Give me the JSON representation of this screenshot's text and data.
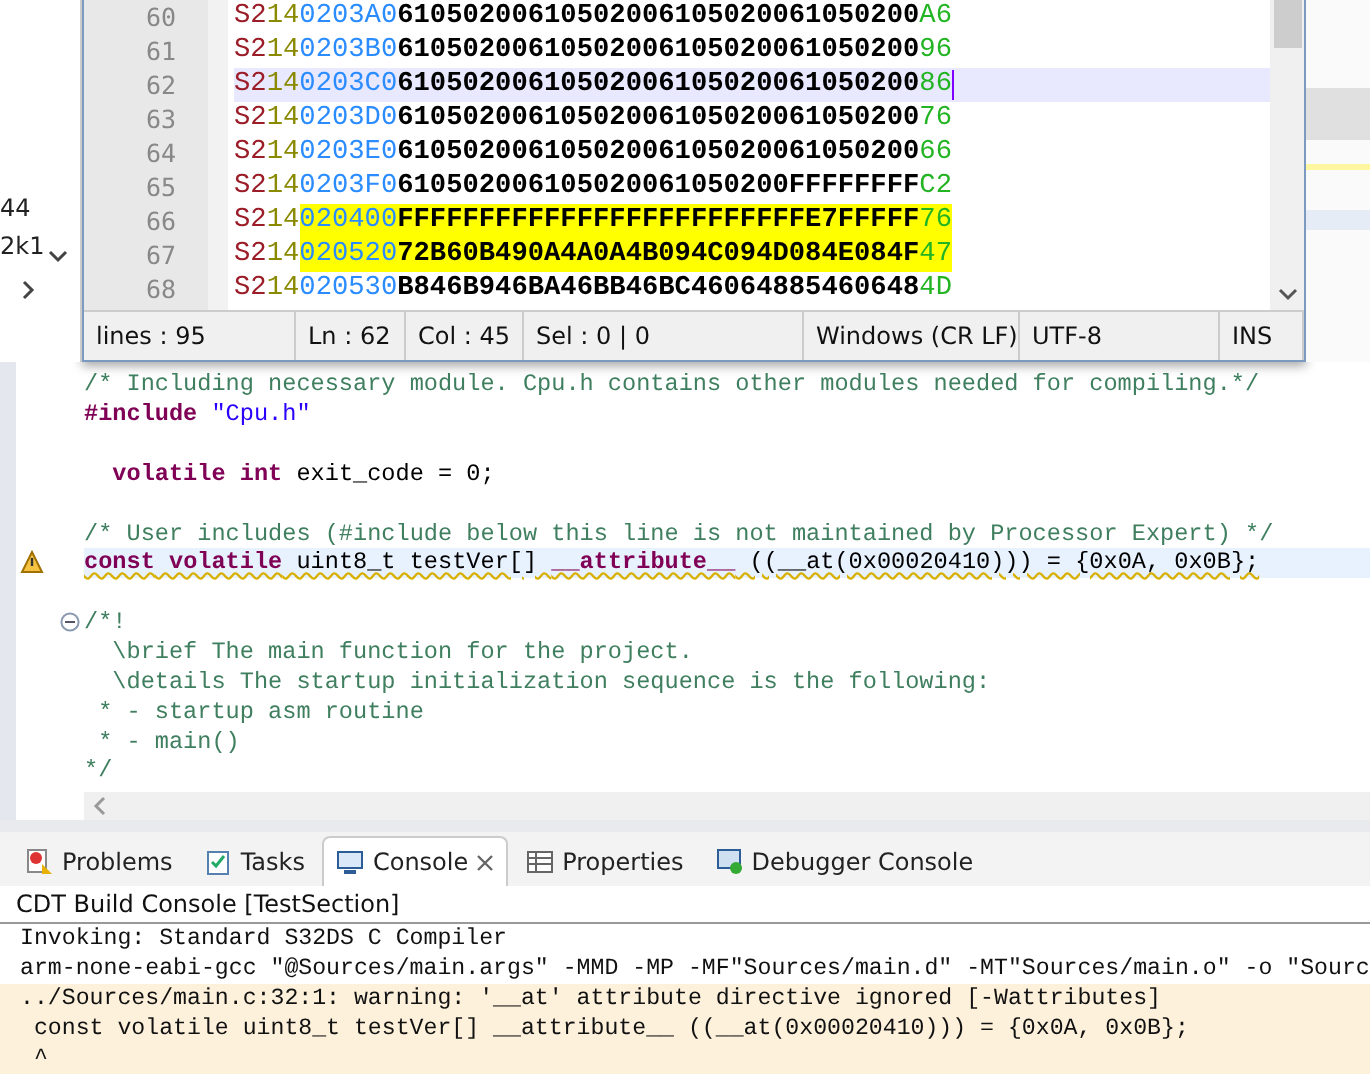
{
  "left_strip": {
    "texts": [
      "44",
      "2k1"
    ]
  },
  "hex_window": {
    "rows": [
      {
        "number": "60",
        "record": "S2",
        "count": "14",
        "address": "0203A0",
        "data": "61050200610502006105020061050200",
        "checksum": "A6",
        "highlighted": false,
        "current": false
      },
      {
        "number": "61",
        "record": "S2",
        "count": "14",
        "address": "0203B0",
        "data": "61050200610502006105020061050200",
        "checksum": "96",
        "highlighted": false,
        "current": false
      },
      {
        "number": "62",
        "record": "S2",
        "count": "14",
        "address": "0203C0",
        "data": "61050200610502006105020061050200",
        "checksum": "86",
        "highlighted": false,
        "current": true
      },
      {
        "number": "63",
        "record": "S2",
        "count": "14",
        "address": "0203D0",
        "data": "61050200610502006105020061050200",
        "checksum": "76",
        "highlighted": false,
        "current": false
      },
      {
        "number": "64",
        "record": "S2",
        "count": "14",
        "address": "0203E0",
        "data": "61050200610502006105020061050200",
        "checksum": "66",
        "highlighted": false,
        "current": false
      },
      {
        "number": "65",
        "record": "S2",
        "count": "14",
        "address": "0203F0",
        "data": "610502006105020061050200FFFFFFFF",
        "checksum": "C2",
        "highlighted": false,
        "current": false
      },
      {
        "number": "66",
        "record": "S2",
        "count": "14",
        "address": "020400",
        "data": "FFFFFFFFFFFFFFFFFFFFFFFFFE7FFFFF",
        "checksum": "76",
        "highlighted": true,
        "current": false
      },
      {
        "number": "67",
        "record": "S2",
        "count": "14",
        "address": "020520",
        "data": "72B60B490A4A0A4B094C094D084E084F",
        "checksum": "47",
        "highlighted": true,
        "current": false
      },
      {
        "number": "68",
        "record": "S2",
        "count": "14",
        "address": "020530",
        "data": "B846B946BA46BB46BC46064885460648",
        "checksum": "4D",
        "highlighted": false,
        "current": false
      }
    ],
    "status_bar": [
      "lines : 95",
      "Ln : 62",
      "Col : 45",
      "Sel : 0 | 0",
      "Windows (CR LF)",
      "UTF-8",
      "INS"
    ]
  },
  "editor": {
    "lines": [
      {
        "kind": "code",
        "warning": false,
        "tokens": [
          {
            "kind": "comment",
            "text": "/* Including necessary module. Cpu.h contains other modules needed for compiling.*/"
          }
        ]
      },
      {
        "kind": "code",
        "warning": false,
        "tokens": [
          {
            "kind": "preproc",
            "text": "#include"
          },
          {
            "kind": "string",
            "text": " \"Cpu.h\""
          }
        ]
      },
      {
        "kind": "blank",
        "warning": false
      },
      {
        "kind": "code",
        "warning": false,
        "tokens": [
          {
            "kind": "keyword",
            "text": "  volatile"
          },
          {
            "kind": "keyword",
            "text": " int"
          },
          {
            "kind": "plain",
            "text": " exit_code = 0;"
          }
        ]
      },
      {
        "kind": "blank",
        "warning": false
      },
      {
        "kind": "code",
        "warning": false,
        "tokens": [
          {
            "kind": "comment",
            "text": "/* User includes (#include below this line is not maintained by Processor Expert) */"
          }
        ]
      },
      {
        "kind": "code",
        "warning": true,
        "tokens": [
          {
            "kind": "keyword",
            "text": "const"
          },
          {
            "kind": "keyword",
            "text": " volatile"
          },
          {
            "kind": "plain",
            "text": " uint8_t testVer[] "
          },
          {
            "kind": "keyword",
            "text": "__attribute__"
          },
          {
            "kind": "plain",
            "text": " ((__at(0x00020410))) = {0x0A, 0x0B};"
          }
        ]
      },
      {
        "kind": "blank",
        "warning": false
      },
      {
        "kind": "fold",
        "warning": false,
        "tokens": [
          {
            "kind": "comment",
            "text": "/*!"
          }
        ]
      },
      {
        "kind": "code",
        "warning": false,
        "tokens": [
          {
            "kind": "comment",
            "text": "  \\brief The main function for the project."
          }
        ]
      },
      {
        "kind": "code",
        "warning": false,
        "tokens": [
          {
            "kind": "comment",
            "text": "  \\details The startup initialization sequence is the following:"
          }
        ]
      },
      {
        "kind": "code",
        "warning": false,
        "tokens": [
          {
            "kind": "comment",
            "text": " * - startup asm routine"
          }
        ]
      },
      {
        "kind": "code",
        "warning": false,
        "tokens": [
          {
            "kind": "comment",
            "text": " * - main()"
          }
        ]
      },
      {
        "kind": "code",
        "warning": false,
        "tokens": [
          {
            "kind": "comment",
            "text": "*/"
          }
        ]
      }
    ]
  },
  "tabs": [
    {
      "label": "Problems",
      "selected": false
    },
    {
      "label": "Tasks",
      "selected": false
    },
    {
      "label": "Console",
      "selected": true
    },
    {
      "label": "Properties",
      "selected": false
    },
    {
      "label": "Debugger Console",
      "selected": false
    }
  ],
  "console": {
    "title": "CDT Build Console [TestSection]",
    "lines": [
      {
        "kind": "normal",
        "text": "Invoking: Standard S32DS C Compiler"
      },
      {
        "kind": "normal",
        "text": "arm-none-eabi-gcc \"@Sources/main.args\" -MMD -MP -MF\"Sources/main.d\" -MT\"Sources/main.o\" -o \"Sourc"
      },
      {
        "kind": "warning",
        "text": "../Sources/main.c:32:1: warning: '__at' attribute directive ignored [-Wattributes]"
      },
      {
        "kind": "warning",
        "text": " const volatile uint8_t testVer[] __attribute__ ((__at(0x00020410))) = {0x0A, 0x0B};"
      },
      {
        "kind": "warning",
        "text": " ^"
      }
    ]
  }
}
